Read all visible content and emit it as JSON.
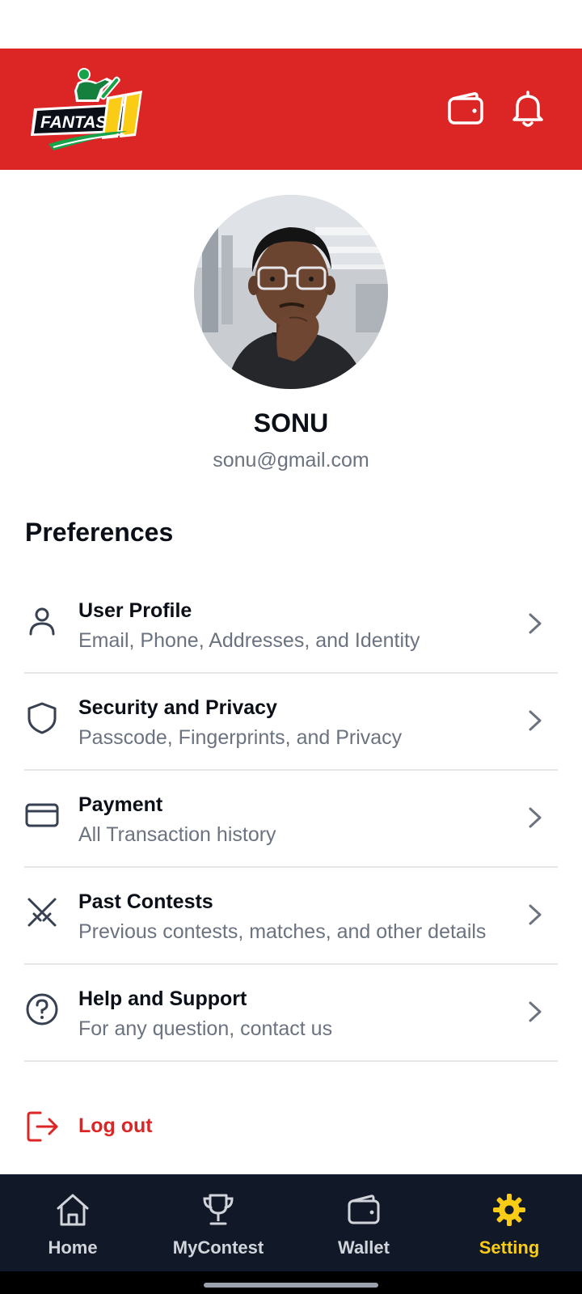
{
  "header": {
    "logo_text": "FANTASY11",
    "wallet_icon": "wallet-icon",
    "bell_icon": "bell-icon"
  },
  "profile": {
    "name": "SONU",
    "email": "sonu@gmail.com"
  },
  "preferences": {
    "title": "Preferences",
    "items": [
      {
        "icon": "user-icon",
        "title": "User Profile",
        "subtitle": "Email, Phone, Addresses, and Identity"
      },
      {
        "icon": "shield-icon",
        "title": "Security and Privacy",
        "subtitle": "Passcode, Fingerprints, and Privacy"
      },
      {
        "icon": "credit-card-icon",
        "title": "Payment",
        "subtitle": "All Transaction history"
      },
      {
        "icon": "swords-icon",
        "title": "Past Contests",
        "subtitle": "Previous contests, matches, and other details"
      },
      {
        "icon": "help-circle-icon",
        "title": "Help and Support",
        "subtitle": "For any question, contact us"
      }
    ]
  },
  "logout": {
    "label": "Log out",
    "icon": "logout-icon"
  },
  "bottom_nav": {
    "items": [
      {
        "icon": "home-icon",
        "label": "Home",
        "active": false
      },
      {
        "icon": "trophy-icon",
        "label": "MyContest",
        "active": false
      },
      {
        "icon": "wallet-icon",
        "label": "Wallet",
        "active": false
      },
      {
        "icon": "gear-icon",
        "label": "Setting",
        "active": true
      }
    ]
  },
  "colors": {
    "brand_red": "#dc2626",
    "nav_background": "#111827",
    "active_accent": "#facc15",
    "muted_text": "#6b7280"
  }
}
